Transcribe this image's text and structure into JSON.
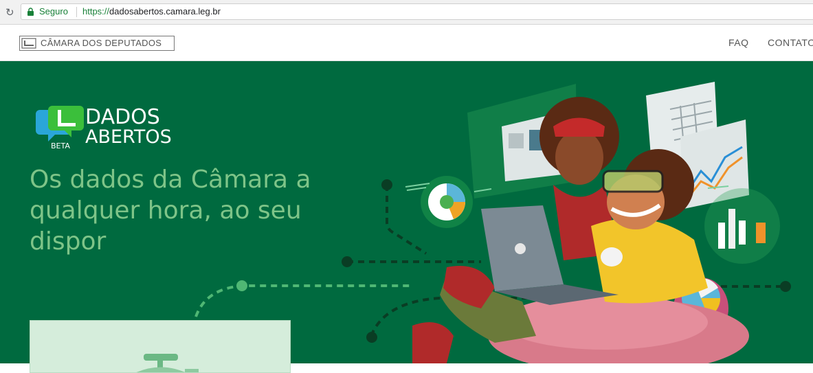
{
  "browser": {
    "security_label": "Seguro",
    "url_protocol": "https://",
    "url_host": "dadosabertos.camara.leg.br",
    "reload_icon": "reload-icon",
    "lock_icon": "lock-icon"
  },
  "header": {
    "logo_text": "CÂMARA DOS DEPUTADOS",
    "nav": [
      {
        "label": "FAQ"
      },
      {
        "label": "CONTATO"
      }
    ]
  },
  "hero": {
    "logo_line1": "DADOS",
    "logo_line2": "ABERTOS",
    "logo_badge": "BETA",
    "tagline": "Os dados da Câmara a qualquer hora, ao seu dispor"
  },
  "colors": {
    "hero_bg": "#006a3f",
    "tagline": "#7ec488",
    "secure_green": "#188038",
    "card_bg": "#d5eddb"
  }
}
